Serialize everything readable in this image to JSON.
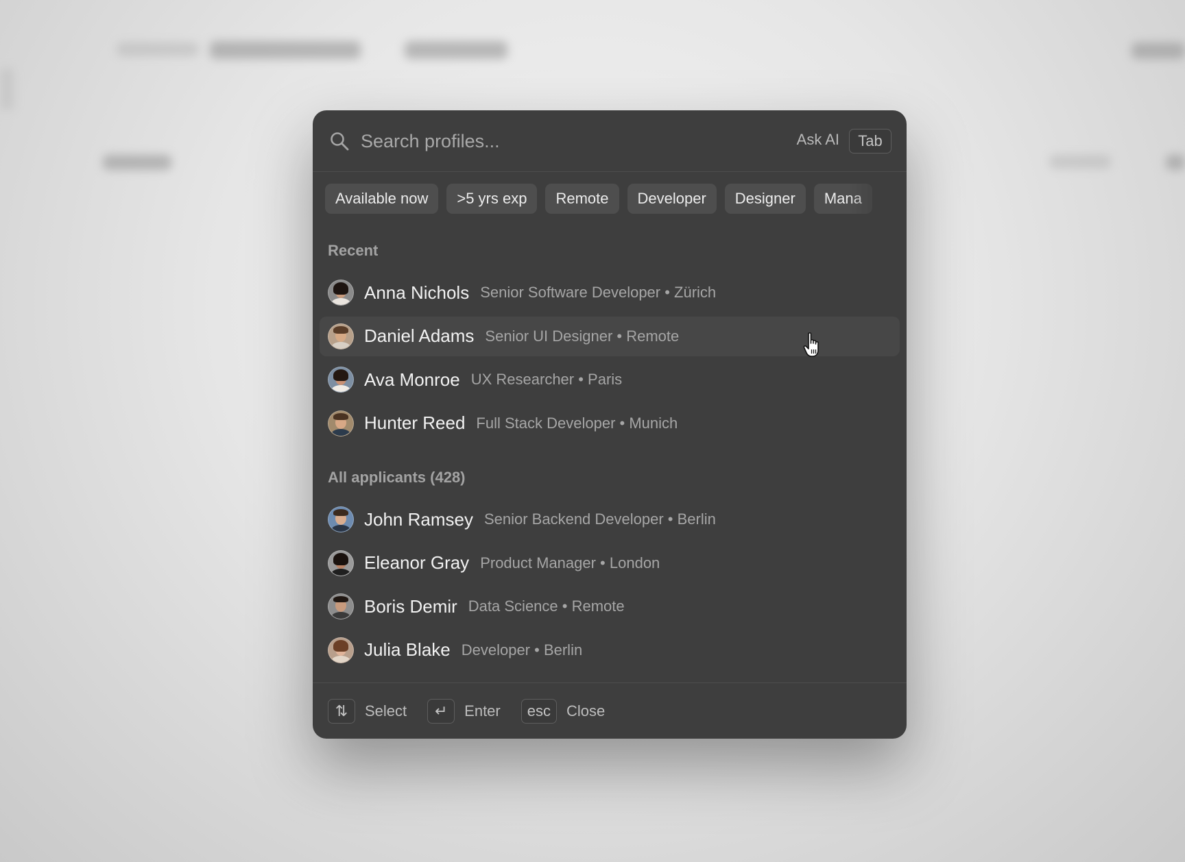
{
  "search": {
    "placeholder": "Search profiles...",
    "ask_ai_label": "Ask AI",
    "ask_ai_key": "Tab"
  },
  "filters": [
    "Available now",
    ">5 yrs exp",
    "Remote",
    "Developer",
    "Designer",
    "Mana"
  ],
  "recent": {
    "label": "Recent",
    "items": [
      {
        "name": "Anna Nichols",
        "meta": "Senior Software Developer • Zürich"
      },
      {
        "name": "Daniel Adams",
        "meta": "Senior UI Designer • Remote"
      },
      {
        "name": "Ava Monroe",
        "meta": "UX Researcher • Paris"
      },
      {
        "name": "Hunter Reed",
        "meta": "Full Stack Developer • Munich"
      }
    ]
  },
  "applicants": {
    "label": "All applicants (428)",
    "items": [
      {
        "name": "John Ramsey",
        "meta": "Senior Backend Developer • Berlin"
      },
      {
        "name": "Eleanor Gray",
        "meta": "Product Manager • London"
      },
      {
        "name": "Boris Demir",
        "meta": "Data Science • Remote"
      },
      {
        "name": "Julia Blake",
        "meta": "Developer • Berlin"
      }
    ]
  },
  "footer": {
    "select_key": "⇅",
    "select_label": "Select",
    "enter_key": "↵",
    "enter_label": "Enter",
    "close_key": "esc",
    "close_label": "Close"
  },
  "colors": {
    "palette_bg": "#3e3e3e",
    "chip_bg": "#4e4e4e",
    "hover_row_bg": "#474747",
    "text_primary": "#f2f2f2",
    "text_secondary": "#a6a6a6"
  }
}
